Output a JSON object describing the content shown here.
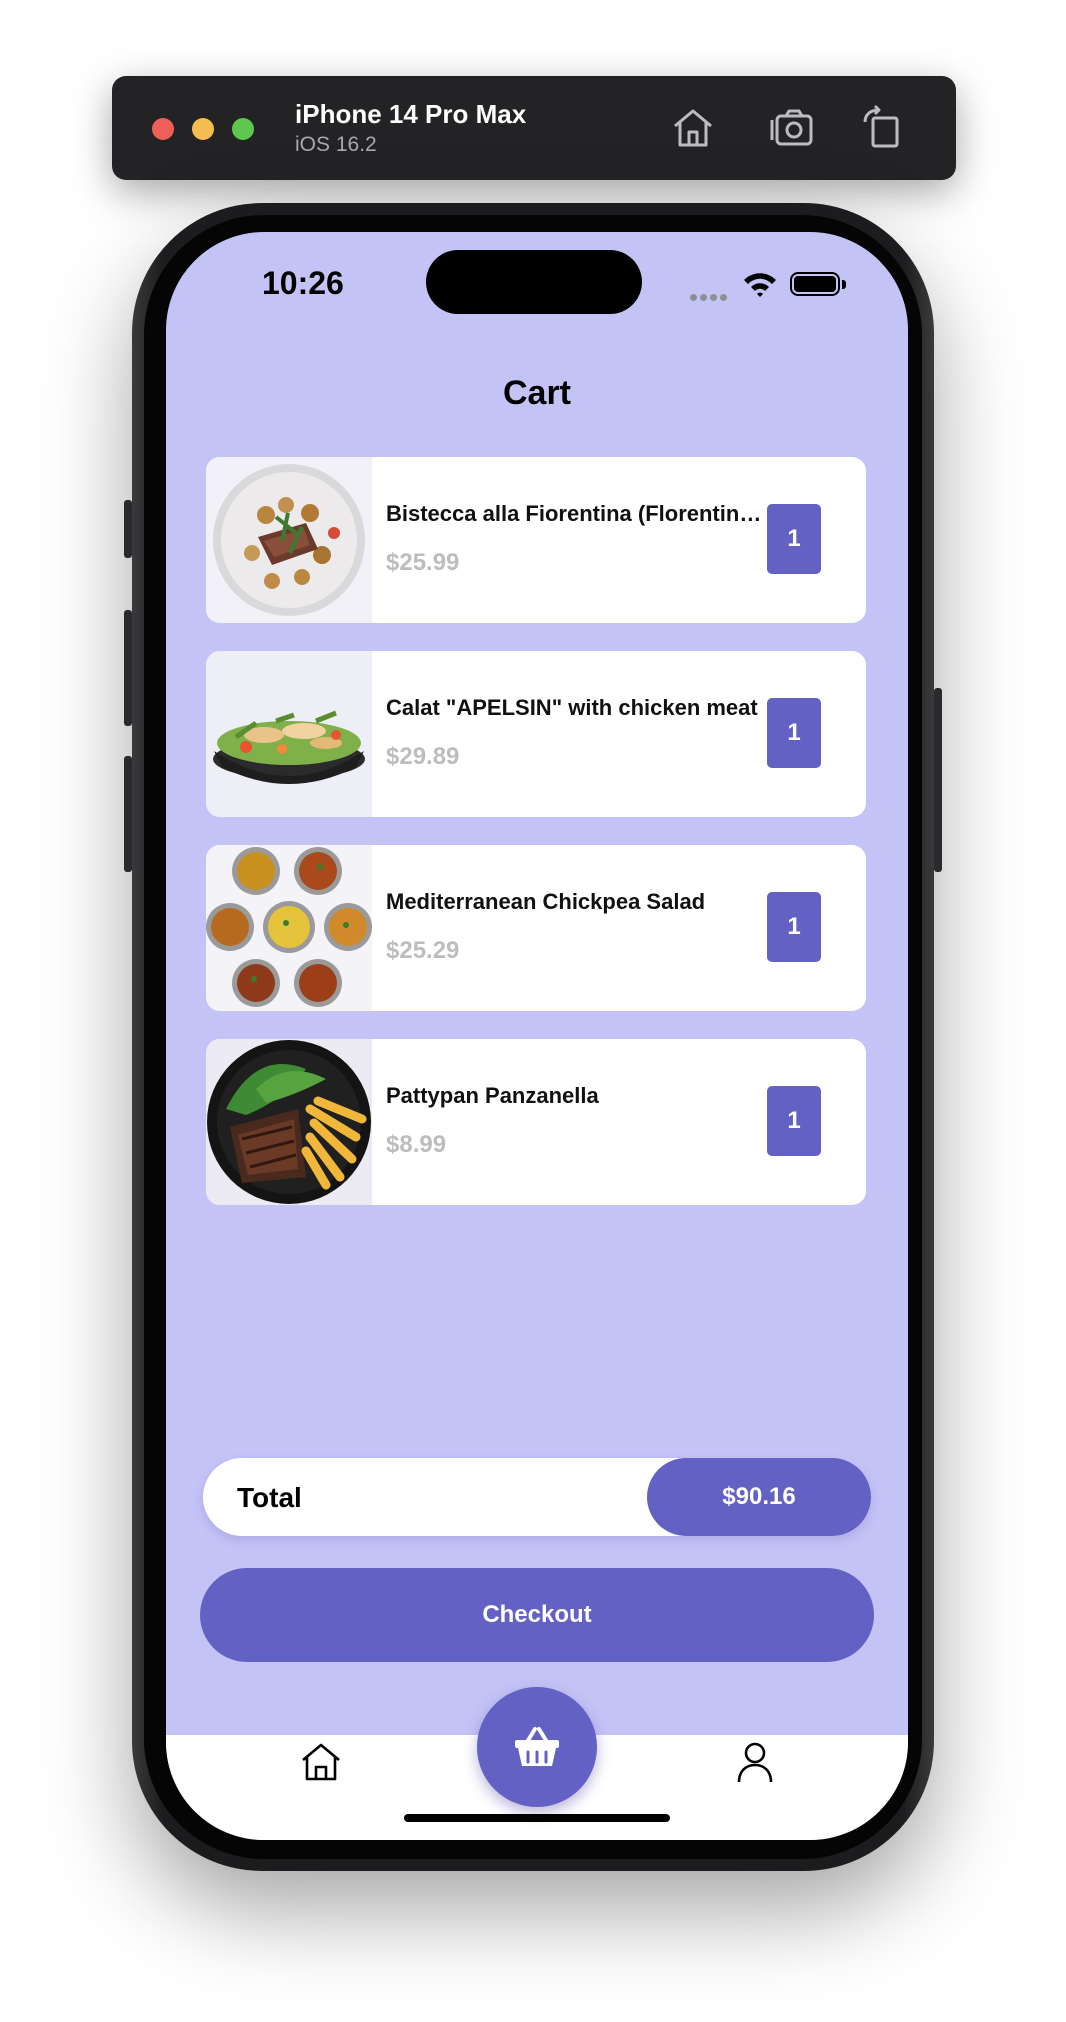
{
  "simulator": {
    "device_name": "iPhone 14 Pro Max",
    "os_version": "iOS 16.2",
    "buttons": [
      "home-icon",
      "screenshot-icon",
      "rotate-icon"
    ]
  },
  "status_bar": {
    "time": "10:26"
  },
  "page": {
    "title": "Cart"
  },
  "cart": {
    "items": [
      {
        "name": "Bistecca alla Fiorentina (Florentine Steak)",
        "price": "$25.99",
        "quantity": "1",
        "image": "steak-with-potatoes-plate"
      },
      {
        "name": "Calat \"APELSIN\" with chicken meat",
        "price": "$29.89",
        "quantity": "1",
        "image": "chicken-salad-bowl"
      },
      {
        "name": "Mediterranean Chickpea Salad",
        "price": "$25.29",
        "quantity": "1",
        "image": "curry-bowls-platter"
      },
      {
        "name": "Pattypan Panzanella",
        "price": "$8.99",
        "quantity": "1",
        "image": "steak-with-fries-plate"
      }
    ]
  },
  "total": {
    "label": "Total",
    "value": "$90.16"
  },
  "checkout": {
    "label": "Checkout"
  },
  "tabbar": {
    "items": [
      "home-icon",
      "basket-icon",
      "profile-icon"
    ],
    "active": "basket-icon"
  },
  "colors": {
    "background": "#c4c3f6",
    "accent": "#6361c4",
    "price_gray": "#bdbdbd"
  }
}
